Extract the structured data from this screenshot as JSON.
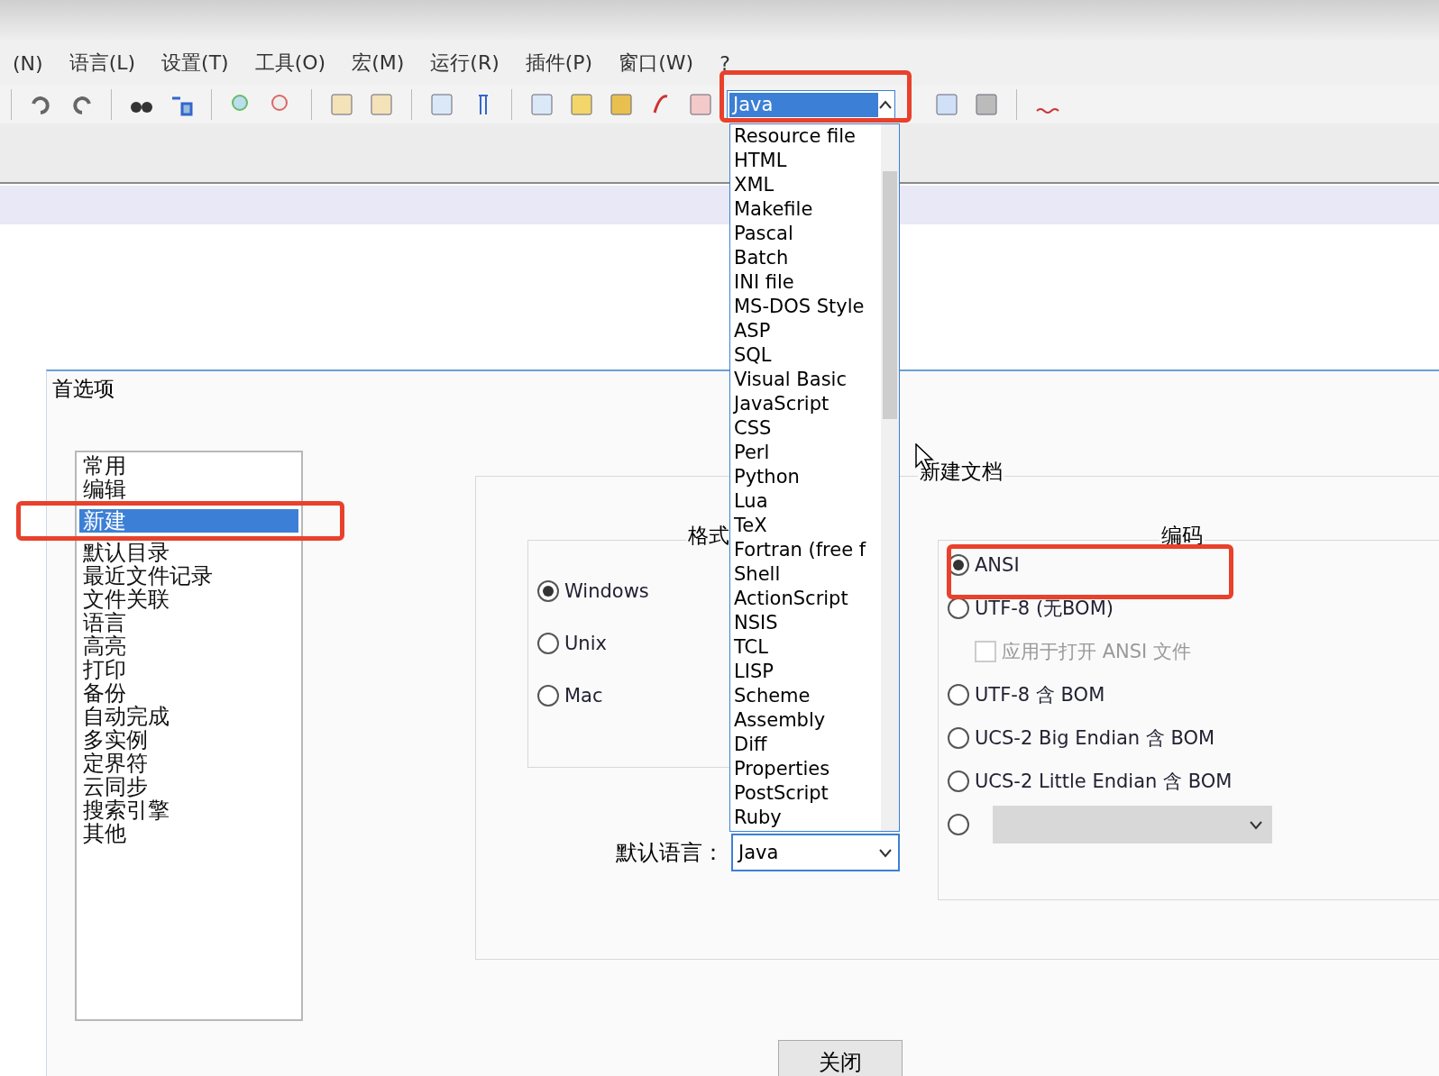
{
  "menu_bar": [
    {
      "label": "(N)"
    },
    {
      "label": "语言(L)"
    },
    {
      "label": "设置(T)"
    },
    {
      "label": "工具(O)"
    },
    {
      "label": "宏(M)"
    },
    {
      "label": "运行(R)"
    },
    {
      "label": "插件(P)"
    },
    {
      "label": "窗口(W)"
    },
    {
      "label": "?"
    }
  ],
  "toolbar": {
    "language_combo": {
      "value": "Java",
      "expanded": true
    }
  },
  "language_dropdown": {
    "items": [
      {
        "label": "Resource file"
      },
      {
        "label": "HTML"
      },
      {
        "label": "XML"
      },
      {
        "label": "Makefile"
      },
      {
        "label": "Pascal"
      },
      {
        "label": "Batch"
      },
      {
        "label": "INI file"
      },
      {
        "label": "MS-DOS Style"
      },
      {
        "label": "ASP"
      },
      {
        "label": "SQL"
      },
      {
        "label": "Visual Basic"
      },
      {
        "label": "JavaScript"
      },
      {
        "label": "CSS"
      },
      {
        "label": "Perl"
      },
      {
        "label": "Python"
      },
      {
        "label": "Lua"
      },
      {
        "label": "TeX"
      },
      {
        "label": "Fortran (free f"
      },
      {
        "label": "Shell"
      },
      {
        "label": "ActionScript"
      },
      {
        "label": "NSIS"
      },
      {
        "label": "TCL"
      },
      {
        "label": "LISP"
      },
      {
        "label": "Scheme"
      },
      {
        "label": "Assembly"
      },
      {
        "label": "Diff"
      },
      {
        "label": "Properties"
      },
      {
        "label": "PostScript"
      },
      {
        "label": "Ruby"
      }
    ]
  },
  "dialog": {
    "title": "首选项",
    "categories": [
      {
        "label": "常用",
        "selected": false
      },
      {
        "label": "编辑",
        "selected": false
      },
      {
        "label": "新建",
        "selected": true
      },
      {
        "label": "默认目录",
        "selected": false
      },
      {
        "label": "最近文件记录",
        "selected": false
      },
      {
        "label": "文件关联",
        "selected": false
      },
      {
        "label": "语言",
        "selected": false
      },
      {
        "label": "高亮",
        "selected": false
      },
      {
        "label": "打印",
        "selected": false
      },
      {
        "label": "备份",
        "selected": false
      },
      {
        "label": "自动完成",
        "selected": false
      },
      {
        "label": "多实例",
        "selected": false
      },
      {
        "label": "定界符",
        "selected": false
      },
      {
        "label": "云同步",
        "selected": false
      },
      {
        "label": "搜索引擎",
        "selected": false
      },
      {
        "label": "其他",
        "selected": false
      }
    ],
    "new_document": {
      "title": "新建文档",
      "format": {
        "title": "格式",
        "options": [
          {
            "label": "Windows",
            "selected": true
          },
          {
            "label": "Unix",
            "selected": false
          },
          {
            "label": "Mac",
            "selected": false
          }
        ]
      },
      "default_language": {
        "label": "默认语言：",
        "value": "Java"
      },
      "encoding": {
        "title": "编码",
        "options": [
          {
            "kind": "radio",
            "label": "ANSI",
            "selected": true
          },
          {
            "kind": "radio",
            "label": "UTF-8 (无BOM)",
            "selected": false
          },
          {
            "kind": "checkbox",
            "label": "应用于打开 ANSI 文件",
            "checked": false,
            "disabled": true
          },
          {
            "kind": "radio",
            "label": "UTF-8 含 BOM",
            "selected": false
          },
          {
            "kind": "radio",
            "label": "UCS-2 Big Endian 含 BOM",
            "selected": false
          },
          {
            "kind": "radio",
            "label": "UCS-2 Little Endian 含 BOM",
            "selected": false
          },
          {
            "kind": "radio_combo",
            "selected": false
          }
        ]
      }
    },
    "close_button": "关闭"
  }
}
